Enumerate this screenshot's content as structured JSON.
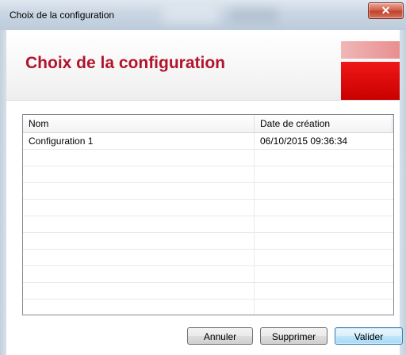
{
  "window": {
    "title": "Choix de la configuration",
    "close_glyph": "✕"
  },
  "banner": {
    "heading": "Choix de la configuration",
    "heading_color": "#b3132b",
    "accent_color": "#e00000"
  },
  "list": {
    "columns": [
      "Nom",
      "Date de création"
    ],
    "rows": [
      [
        "Configuration 1",
        "06/10/2015 09:36:34"
      ],
      [
        "",
        ""
      ],
      [
        "",
        ""
      ],
      [
        "",
        ""
      ],
      [
        "",
        ""
      ],
      [
        "",
        ""
      ],
      [
        "",
        ""
      ],
      [
        "",
        ""
      ],
      [
        "",
        ""
      ],
      [
        "",
        ""
      ],
      [
        "",
        ""
      ]
    ]
  },
  "buttons": {
    "cancel": "Annuler",
    "delete": "Supprimer",
    "ok": "Valider"
  }
}
